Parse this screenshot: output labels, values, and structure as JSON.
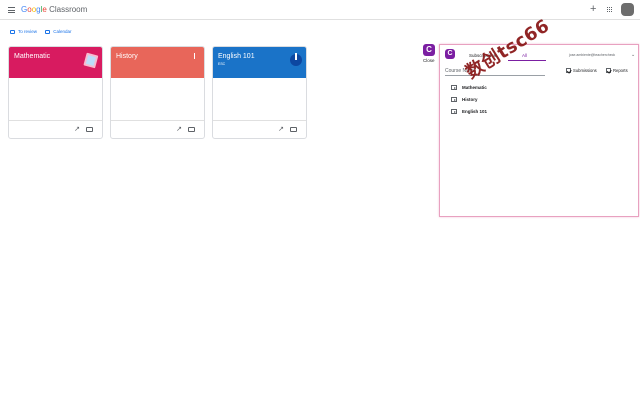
{
  "app": {
    "logo_parts": [
      "G",
      "o",
      "o",
      "g",
      "l",
      "e"
    ],
    "product": "Classroom"
  },
  "subnav": {
    "to_review": "To review",
    "calendar": "Calendar"
  },
  "classes": [
    {
      "name": "Mathematic",
      "section": "",
      "color": "#d81b60"
    },
    {
      "name": "History",
      "section": "",
      "color": "#e8665a"
    },
    {
      "name": "English 101",
      "section": "ESC",
      "color": "#1a73c8"
    }
  ],
  "extension": {
    "side_label": "Close",
    "badge_letter": "C",
    "tabs": [
      "Subscriptions",
      "All"
    ],
    "active_tab": "All",
    "account_email": "jose.ambiente@teachercheck",
    "search_placeholder": "Course Name",
    "filters": [
      {
        "label": "Submissions",
        "checked": true
      },
      {
        "label": "Reports",
        "checked": true
      }
    ],
    "courses": [
      "Mathematic",
      "History",
      "English 101"
    ]
  },
  "watermark": "数创tsc66",
  "icons": {
    "menu": "menu-icon",
    "add": "plus-icon",
    "apps": "apps-grid-icon",
    "trend": "trending-icon",
    "folder": "folder-icon",
    "more": "more-vert-icon"
  }
}
